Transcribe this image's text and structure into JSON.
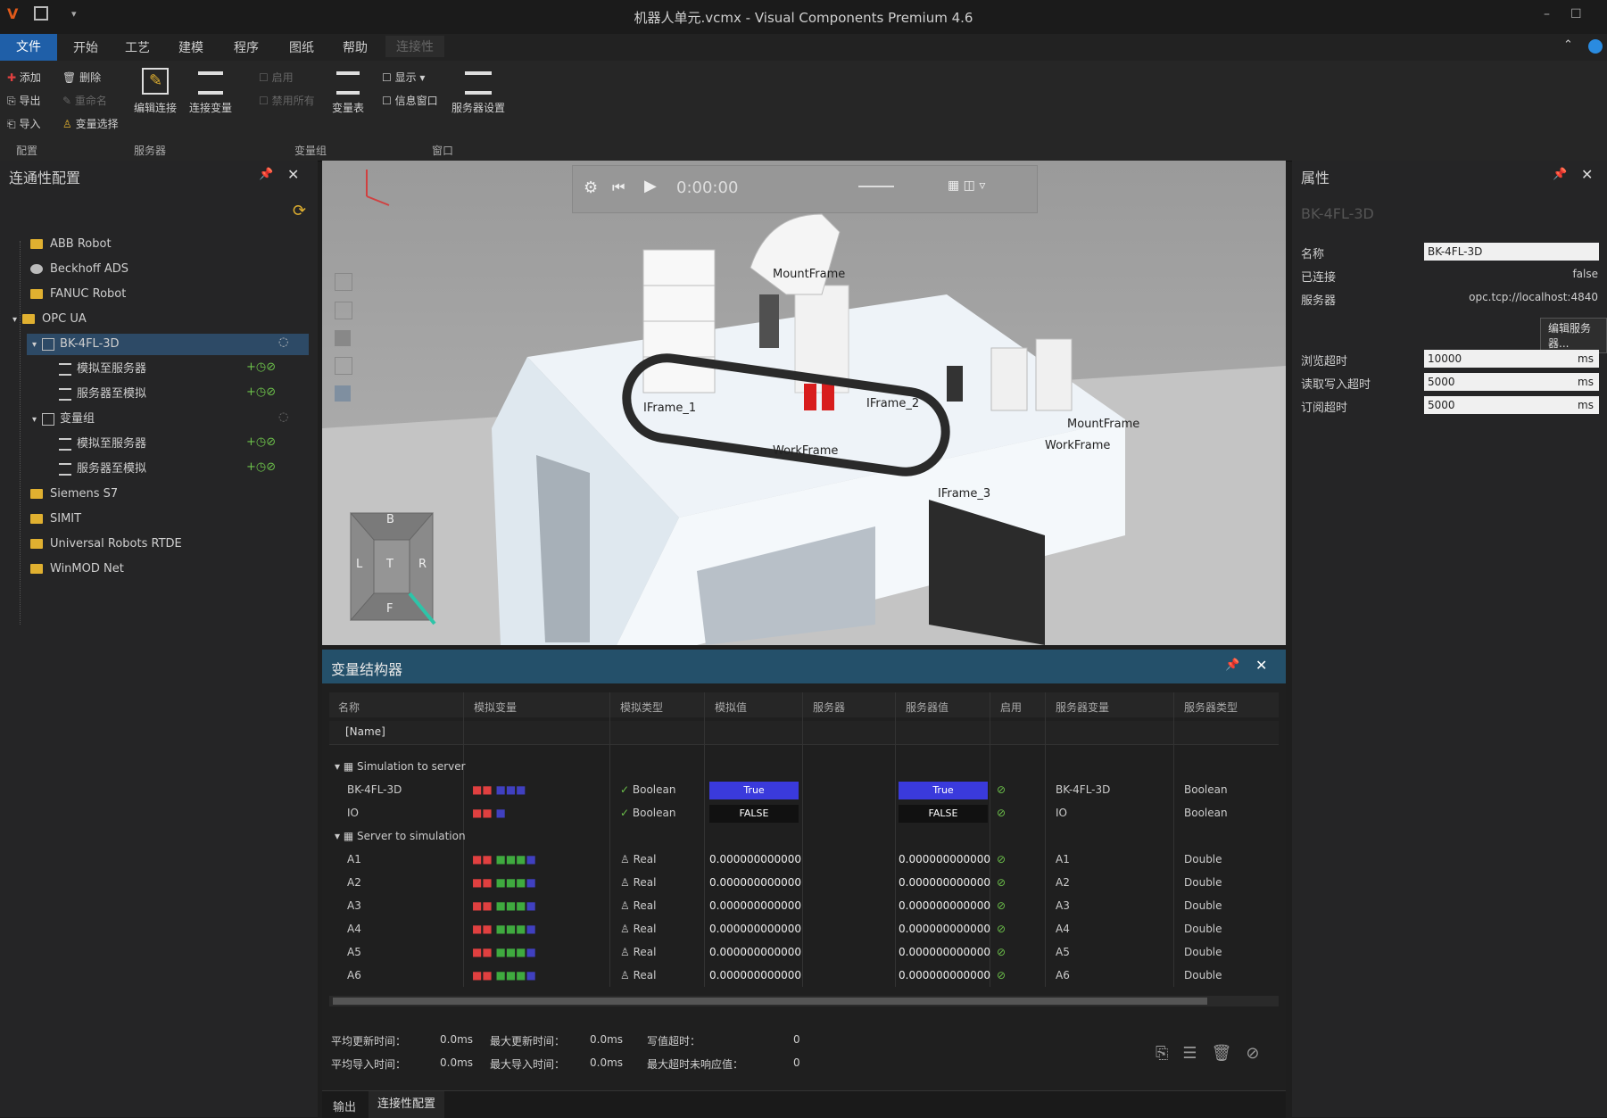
{
  "window": {
    "title": "机器人单元.vcmx - Visual Components Premium 4.6"
  },
  "menu": [
    "文件",
    "开始",
    "工艺",
    "建模",
    "程序",
    "图纸",
    "帮助",
    "连接性"
  ],
  "ribbon": {
    "left_buttons": [
      "添加",
      "删除",
      "导出",
      "重命名",
      "导入",
      "变量选择"
    ],
    "big_buttons": [
      "编辑连接",
      "连接变量",
      "变量表"
    ],
    "dim_buttons": [
      "启用",
      "禁用所有"
    ],
    "small_right": [
      "显示",
      "信息窗口"
    ],
    "big_right": "服务器设置",
    "groups": [
      "配置",
      "服务器",
      "变量组",
      "窗口"
    ]
  },
  "connectivity_tree": {
    "title": "连通性配置",
    "items": [
      {
        "label": "ABB Robot",
        "level": 1
      },
      {
        "label": "Beckhoff ADS",
        "level": 1
      },
      {
        "label": "FANUC Robot",
        "level": 1
      },
      {
        "label": "OPC UA",
        "level": 1
      },
      {
        "label": "BK-4FL-3D",
        "level": 2
      },
      {
        "label": "模拟至服务器",
        "level": 3
      },
      {
        "label": "服务器至模拟",
        "level": 3
      },
      {
        "label": "变量组",
        "level": 2
      },
      {
        "label": "模拟至服务器",
        "level": 3
      },
      {
        "label": "服务器至模拟",
        "level": 3
      },
      {
        "label": "Siemens S7",
        "level": 1
      },
      {
        "label": "SIMIT",
        "level": 1
      },
      {
        "label": "Universal Robots RTDE",
        "level": 1
      },
      {
        "label": "WinMOD Net",
        "level": 1
      }
    ]
  },
  "viewport": {
    "time": "0:00:00",
    "labels": [
      "MountFrame",
      "IFrame_1",
      "IFrame_2",
      "WorkFrame",
      "WorkFrame",
      "MountFrame",
      "IFrame_3"
    ],
    "nav_cube": [
      "B",
      "L",
      "T",
      "R",
      "F"
    ]
  },
  "variables_panel": {
    "title": "变量结构器",
    "columns": [
      "名称",
      "模拟变量",
      "模拟类型",
      "模拟值",
      "服务器",
      "服务器值",
      "启用",
      "服务器变量",
      "服务器类型"
    ],
    "filter_value": "[Name]",
    "groups": [
      {
        "label": "Simulation to server",
        "rows": [
          {
            "name": "BK-4FL-3D",
            "sim_type": "Boolean",
            "sim_value": "True",
            "server_value": "True",
            "server_var": "BK-4FL-3D",
            "server_type": "Boolean"
          },
          {
            "name": "IO",
            "sim_type": "Boolean",
            "sim_value": "FALSE",
            "server_value": "FALSE",
            "server_var": "IO",
            "server_type": "Boolean"
          }
        ]
      },
      {
        "label": "Server to simulation",
        "rows": [
          {
            "name": "A1",
            "sim_type": "Real",
            "sim_value": "0.000000000000",
            "server_value": "0.000000000000",
            "server_var": "A1",
            "server_type": "Double"
          },
          {
            "name": "A2",
            "sim_type": "Real",
            "sim_value": "0.000000000000",
            "server_value": "0.000000000000",
            "server_var": "A2",
            "server_type": "Double"
          },
          {
            "name": "A3",
            "sim_type": "Real",
            "sim_value": "0.000000000000",
            "server_value": "0.000000000000",
            "server_var": "A3",
            "server_type": "Double"
          },
          {
            "name": "A4",
            "sim_type": "Real",
            "sim_value": "0.000000000000",
            "server_value": "0.000000000000",
            "server_var": "A4",
            "server_type": "Double"
          },
          {
            "name": "A5",
            "sim_type": "Real",
            "sim_value": "0.000000000000",
            "server_value": "0.000000000000",
            "server_var": "A5",
            "server_type": "Double"
          },
          {
            "name": "A6",
            "sim_type": "Real",
            "sim_value": "0.000000000000",
            "server_value": "0.000000000000",
            "server_var": "A6",
            "server_type": "Double"
          }
        ]
      }
    ],
    "stats": [
      {
        "label": "平均更新时间：",
        "value": "0.0ms"
      },
      {
        "label": "最大更新时间：",
        "value": "0.0ms"
      },
      {
        "label": "写值超时：",
        "value": "0"
      },
      {
        "label": "平均导入时间：",
        "value": "0.0ms"
      },
      {
        "label": "最大导入时间：",
        "value": "0.0ms"
      },
      {
        "label": "最大超时未响应值：",
        "value": "0"
      }
    ],
    "bottom_tabs": [
      "输出",
      "连接性配置"
    ]
  },
  "properties": {
    "title": "属性",
    "selected": "BK-4FL-3D",
    "fields": [
      {
        "label": "名称",
        "value": "BK-4FL-3D"
      },
      {
        "label": "已连接",
        "value": "false"
      },
      {
        "label": "服务器",
        "value": "opc.tcp://localhost:4840"
      }
    ],
    "edit_button": "编辑服务器...",
    "timings": [
      {
        "label": "浏览超时",
        "value": "10000",
        "unit": "ms"
      },
      {
        "label": "读取写入超时",
        "value": "5000",
        "unit": "ms"
      },
      {
        "label": "订阅超时",
        "value": "5000",
        "unit": "ms"
      }
    ]
  },
  "colors": {
    "accent": "#1f5fa8",
    "panel_header": "#24506a",
    "true_toggle": "#3a3adc"
  }
}
